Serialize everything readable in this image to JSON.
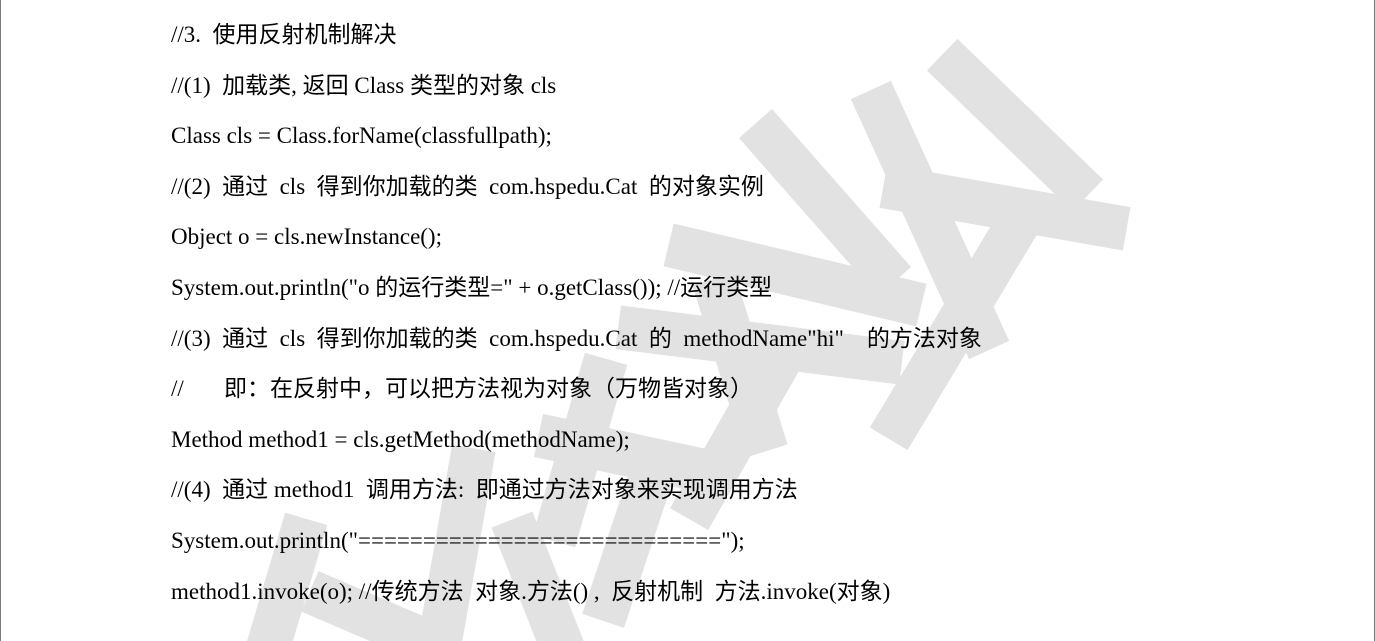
{
  "watermark": {
    "color": "#e2e2e2"
  },
  "lines": [
    "//3.  使用反射机制解决",
    "//(1)  加载类, 返回 Class 类型的对象 cls",
    "Class cls = Class.forName(classfullpath);",
    "//(2)  通过  cls  得到你加载的类  com.hspedu.Cat  的对象实例",
    "Object o = cls.newInstance();",
    "System.out.println(\"o 的运行类型=\" + o.getClass()); //运行类型",
    "//(3)  通过  cls  得到你加载的类  com.hspedu.Cat  的  methodName\"hi\"    的方法对象",
    "//       即：在反射中，可以把方法视为对象（万物皆对象）",
    "Method method1 = cls.getMethod(methodName);",
    "//(4)  通过 method1  调用方法:  即通过方法对象来实现调用方法",
    "System.out.println(\"============================\");",
    "method1.invoke(o); //传统方法  对象.方法() ,  反射机制  方法.invoke(对象)"
  ]
}
